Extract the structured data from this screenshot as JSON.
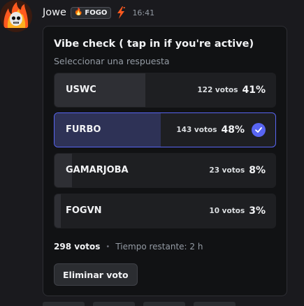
{
  "message": {
    "author": "Jowe",
    "tag": {
      "icon": "flame-icon",
      "label": "FOGO"
    },
    "badge_icon": "lightning-bolt-icon",
    "timestamp": "16:41"
  },
  "poll": {
    "question": "Vibe check ( tap in if you're active)",
    "prompt": "Seleccionar una respuesta",
    "options": [
      {
        "label": "USWC",
        "votes": "122 votos",
        "percent": "41%",
        "share": 0.41,
        "selected": false
      },
      {
        "label": "FURBO",
        "votes": "143 votos",
        "percent": "48%",
        "share": 0.48,
        "selected": true
      },
      {
        "label": "GAMARJOBA",
        "votes": "23 votos",
        "percent": "8%",
        "share": 0.08,
        "selected": false
      },
      {
        "label": "FOGVN",
        "votes": "10 votos",
        "percent": "3%",
        "share": 0.03,
        "selected": false
      }
    ],
    "total_votes": "298 votos",
    "separator": "•",
    "time_left": "Tiempo restante: 2 h",
    "remove_vote_label": "Eliminar voto"
  },
  "colors": {
    "accent": "#5865f2",
    "flame": "#ff5a1f",
    "selected_fill": "#2e3256"
  }
}
